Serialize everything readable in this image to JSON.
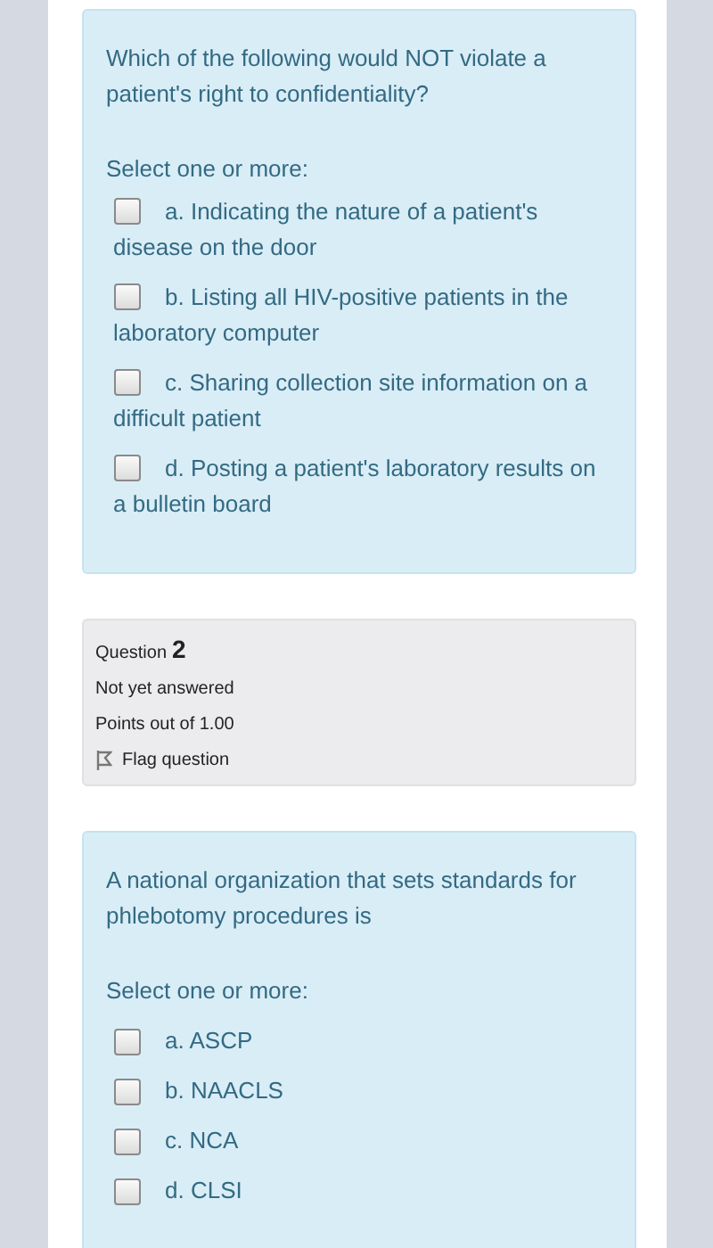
{
  "questions": [
    {
      "kind": "content",
      "text": "Which of the following would NOT violate a patient's right to confidentiality?",
      "prompt": "Select one or more:",
      "options": [
        {
          "label": "a. Indicating the nature of a patient's disease on the door",
          "checked": false
        },
        {
          "label": "b. Listing all HIV-positive patients in the laboratory computer",
          "checked": false
        },
        {
          "label": "c. Sharing collection site information on a difficult patient",
          "checked": false
        },
        {
          "label": "d. Posting a patient's laboratory results on a bulletin board",
          "checked": false
        }
      ]
    },
    {
      "kind": "info",
      "label": "Question",
      "number": "2",
      "status": "Not yet answered",
      "points": "Points out of 1.00",
      "flag": "Flag question"
    },
    {
      "kind": "content",
      "text": "A national organization that sets standards for phlebotomy procedures is",
      "prompt": "Select one or more:",
      "options": [
        {
          "label": "a. ASCP",
          "checked": false
        },
        {
          "label": "b. NAACLS",
          "checked": false
        },
        {
          "label": "c. NCA",
          "checked": false
        },
        {
          "label": "d. CLSI",
          "checked": false
        }
      ]
    }
  ]
}
